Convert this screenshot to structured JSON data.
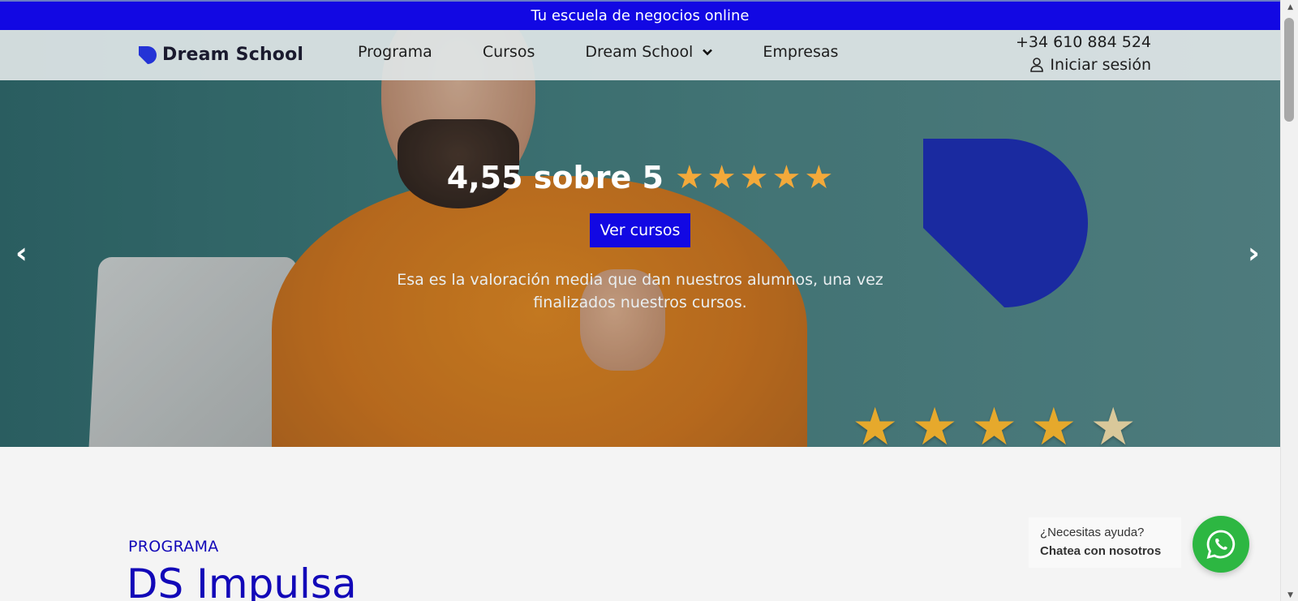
{
  "topbar": {
    "text": "Tu escuela de negocios online"
  },
  "header": {
    "brand": "Dream School",
    "nav": [
      {
        "label": "Programa"
      },
      {
        "label": "Cursos"
      },
      {
        "label": "Dream School",
        "has_dropdown": true
      },
      {
        "label": "Empresas"
      }
    ],
    "phone": "+34 610 884 524",
    "login": "Iniciar sesión"
  },
  "hero": {
    "rating": "4,55 sobre 5",
    "rating_stars": 5,
    "cta": "Ver cursos",
    "description": "Esa es la valoración media que dan nuestros alumnos, una vez finalizados nuestros cursos."
  },
  "section": {
    "label": "PROGRAMA",
    "title": "DS Impulsa"
  },
  "help": {
    "question": "¿Necesitas ayuda?",
    "cta": "Chatea con nosotros"
  },
  "colors": {
    "brand_blue": "#1208e3",
    "star": "#f3a93a",
    "whatsapp": "#2db742"
  }
}
